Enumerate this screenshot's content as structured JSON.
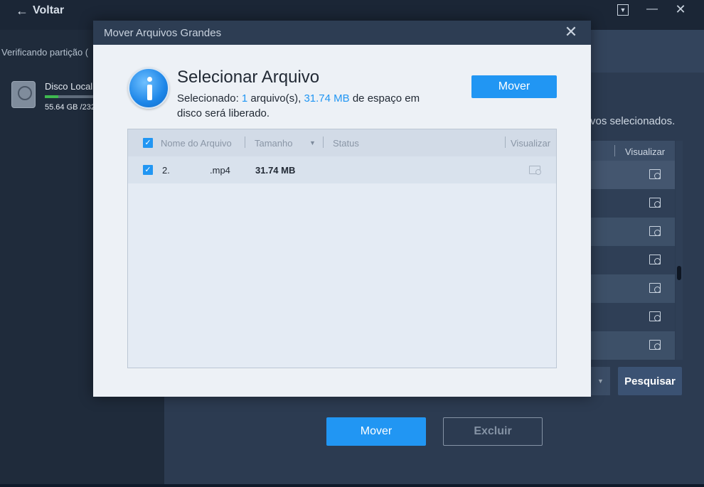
{
  "app": {
    "back_label": "Voltar",
    "verifying_text": "Verificando partição (",
    "disk_name": "Disco Local",
    "disk_usage": "55.64 GB /232",
    "disk_fill_fraction": 0.24,
    "selected_text": "vos selecionados.",
    "bg_table_header": "Visualizar",
    "bg_row_count": 7,
    "search_label": "Pesquisar",
    "move_label": "Mover",
    "delete_label": "Excluir"
  },
  "modal": {
    "title": "Mover Arquivos Grandes",
    "heading": "Selecionar Arquivo",
    "desc_prefix": "Selecionado: ",
    "count": "1",
    "desc_mid": " arquivo(s), ",
    "size": "31.74 MB",
    "desc_suffix": " de espaço em disco será liberado.",
    "move_label": "Mover",
    "table": {
      "headers": {
        "name": "Nome do Arquivo",
        "size": "Tamanho",
        "status": "Status",
        "preview": "Visualizar"
      },
      "rows": [
        {
          "name": "2.",
          "ext": ".mp4",
          "size": "31.74 MB",
          "status": ""
        }
      ]
    }
  },
  "colors": {
    "accent": "#2196f3",
    "titlebar": "#2d3d53",
    "modal_bg": "#edf1f6",
    "app_bg": "#1f2c3d"
  }
}
